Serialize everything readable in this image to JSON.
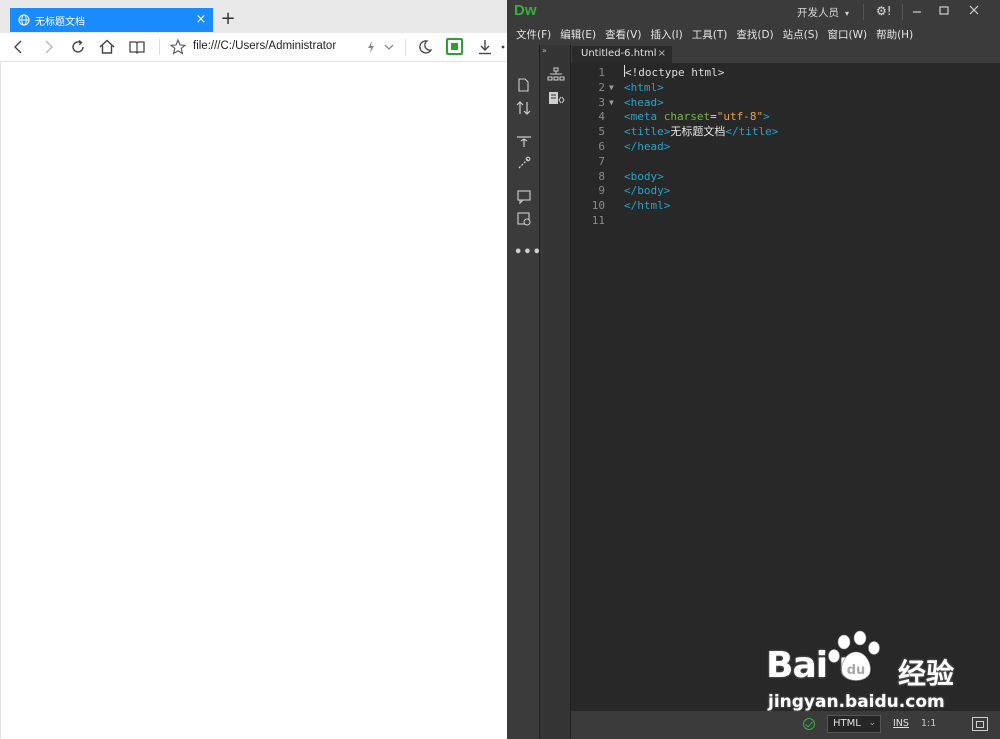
{
  "browser": {
    "tab_title": "无标题文档",
    "tab_close": "×",
    "new_tab": "+",
    "url": "file:///C:/Users/Administrator"
  },
  "dw": {
    "logo": "Dw",
    "workspace": "开发人员",
    "workspace_caret": "▾",
    "gear": "⚙!",
    "menu": [
      "文件(F)",
      "编辑(E)",
      "查看(V)",
      "插入(I)",
      "工具(T)",
      "查找(D)",
      "站点(S)",
      "窗口(W)",
      "帮助(H)"
    ],
    "doc_tab": "Untitled-6.html",
    "doc_tab_close": "×",
    "collapse": "»",
    "more": "•••",
    "status": {
      "language": "HTML",
      "mode": "INS",
      "position": "1:1"
    },
    "code_lines": [
      {
        "n": "1",
        "fold": "",
        "html": "<span class=\"cursor\"></span>&lt;!doctype html&gt;"
      },
      {
        "n": "2",
        "fold": "▼",
        "html": "<span class=\"tag\">&lt;html&gt;</span>"
      },
      {
        "n": "3",
        "fold": "▼",
        "html": "<span class=\"tag\">&lt;head&gt;</span>"
      },
      {
        "n": "4",
        "fold": "",
        "html": "<span class=\"tag\">&lt;meta</span> <span class=\"attr\">charset</span>=<span class=\"str\">\"utf-8\"</span><span class=\"tag\">&gt;</span>"
      },
      {
        "n": "5",
        "fold": "",
        "html": "<span class=\"tag\">&lt;title&gt;</span><span class=\"txt\">无标题文档</span><span class=\"tag\">&lt;/title&gt;</span>"
      },
      {
        "n": "6",
        "fold": "",
        "html": "<span class=\"tag\">&lt;/head&gt;</span>"
      },
      {
        "n": "7",
        "fold": "",
        "html": ""
      },
      {
        "n": "8",
        "fold": "",
        "html": "<span class=\"tag\">&lt;body&gt;</span>"
      },
      {
        "n": "9",
        "fold": "",
        "html": "<span class=\"tag\">&lt;/body&gt;</span>"
      },
      {
        "n": "10",
        "fold": "",
        "html": "<span class=\"tag\">&lt;/html&gt;</span>"
      },
      {
        "n": "11",
        "fold": "",
        "html": ""
      }
    ]
  },
  "watermark": {
    "brand": "Bai   u",
    "brand_cn": "经验",
    "url": "jingyan.baidu.com"
  }
}
